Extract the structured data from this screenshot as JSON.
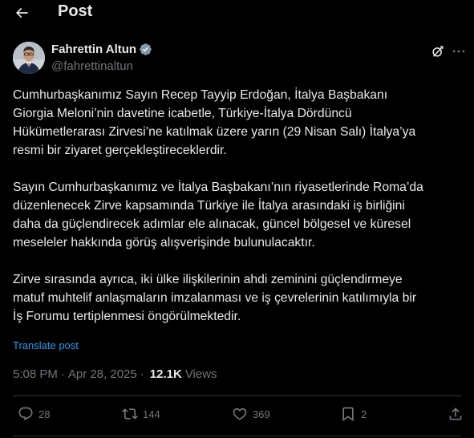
{
  "header": {
    "title": "Post"
  },
  "author": {
    "name": "Fahrettin Altun",
    "handle": "@fahrettinaltun"
  },
  "tweet": {
    "paragraphs": [
      "Cumhurbaşkanımız Sayın Recep Tayyip Erdoğan, İtalya Başbakanı\nGiorgia Meloni’nin davetine icabetle, Türkiye-İtalya Dördüncü\nHükümetlerarası Zirvesi’ne katılmak üzere yarın (29 Nisan Salı) İtalya’ya\nresmi bir ziyaret gerçekleştireceklerdir.",
      "Sayın Cumhurbaşkanımız ve İtalya Başbakanı’nın riyasetlerinde Roma’da\ndüzenlenecek Zirve kapsamında Türkiye ile İtalya arasındaki iş birliğini\ndaha da güçlendirecek adımlar ele alınacak, güncel bölgesel ve küresel\nmeseleler hakkında görüş alışverişinde bulunulacaktır.",
      "Zirve sırasında ayrıca, iki ülke ilişkilerinin ahdi zeminini güçlendirmeye\nmatuf muhtelif anlaşmaların imzalanması ve iş çevrelerinin katılımıyla bir\nİş Forumu tertiplenmesi öngörülmektedir."
    ],
    "translate_label": "Translate post"
  },
  "meta": {
    "time": "5:08 PM",
    "separator": "·",
    "date": "Apr 28, 2025",
    "views_count": "12.1K",
    "views_label": "Views"
  },
  "actions": {
    "replies": "28",
    "reposts": "144",
    "likes": "369",
    "bookmarks": "2"
  },
  "colors": {
    "background": "#000000",
    "text": "#e7e9ea",
    "secondary": "#71767b",
    "accent": "#1d9bf0",
    "divider": "#2f3336"
  },
  "icons": {
    "back": "arrow-left-icon",
    "verified": "verified-badge-icon",
    "grok": "grok-icon",
    "more": "more-dots-icon",
    "reply": "reply-icon",
    "repost": "repost-icon",
    "like": "heart-icon",
    "bookmark": "bookmark-icon",
    "share": "share-icon"
  }
}
